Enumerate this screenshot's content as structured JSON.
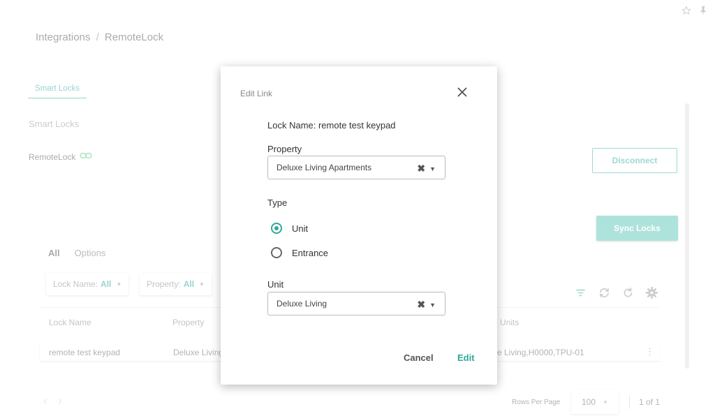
{
  "breadcrumb": {
    "parent": "Integrations",
    "separator": "/",
    "current": "RemoteLock"
  },
  "tabs": {
    "smart_locks": "Smart Locks"
  },
  "section": {
    "title": "Smart Locks"
  },
  "provider": {
    "name": "RemoteLock",
    "icon": "link-icon",
    "icon_color": "#5cc47a"
  },
  "buttons": {
    "disconnect": "Disconnect",
    "sync_locks": "Sync Locks"
  },
  "view_tabs": {
    "all": "All",
    "options": "Options"
  },
  "filters": [
    {
      "label": "Lock Name:",
      "value": "All"
    },
    {
      "label": "Property:",
      "value": "All"
    }
  ],
  "toolbar_icons": [
    "filter-icon",
    "sync-icon",
    "refresh-icon",
    "settings-icon"
  ],
  "table": {
    "headers": {
      "lock_name": "Lock Name",
      "property": "Property",
      "units": "Units"
    },
    "rows": [
      {
        "lock_name": "remote test keypad",
        "property": "Deluxe Living",
        "units": "e Living,H0000,TPU-01"
      }
    ]
  },
  "pagination": {
    "rows_per_page_label": "Rows Per Page",
    "rows_per_page": "100",
    "page_info": "1 of 1"
  },
  "modal": {
    "title": "Edit Link",
    "lock_name": "Lock Name: remote test keypad",
    "property_label": "Property",
    "property_value": "Deluxe Living Apartments",
    "type_label": "Type",
    "type_options": [
      {
        "label": "Unit",
        "checked": true
      },
      {
        "label": "Entrance",
        "checked": false
      }
    ],
    "unit_label": "Unit",
    "unit_value": "Deluxe Living",
    "cancel": "Cancel",
    "edit": "Edit"
  },
  "colors": {
    "accent": "#2ea89a",
    "sync_button": "#5cc6b8"
  }
}
